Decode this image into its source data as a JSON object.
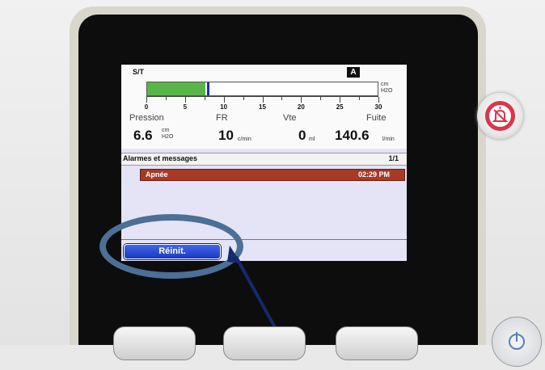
{
  "screen": {
    "mode": "S/T",
    "mode_badge": "A",
    "pressure_bar": {
      "scale_max": 30,
      "fill_value": 7.5,
      "marker_value": 7.8,
      "unit_top": "cm",
      "unit_bottom": "H2O",
      "ticks": [
        "0",
        "5",
        "10",
        "15",
        "20",
        "25",
        "30"
      ]
    },
    "params": [
      {
        "label": "Pression",
        "value": "6.6",
        "unit_top": "cm",
        "unit_bottom": "H2O"
      },
      {
        "label": "FR",
        "value": "10",
        "unit": "c/min"
      },
      {
        "label": "Vte",
        "value": "0",
        "unit": "ml"
      },
      {
        "label": "Fuite",
        "value": "140.6",
        "unit": "l/min"
      }
    ],
    "messages": {
      "title": "Alarmes et messages",
      "count": "1/1",
      "alarms": [
        {
          "name": "Apnée",
          "time": "02:29 PM"
        }
      ]
    },
    "reset_button": "Réinit."
  },
  "colors": {
    "bar_fill": "#58b649",
    "bar_marker": "#1b2fb8",
    "alarm_row": "#a73a25",
    "reset_button": "#2a4fd6",
    "highlight_ring": "#4b6f96",
    "arrow": "#16296b",
    "alarm_mute_ring": "#d9364c"
  },
  "icons": {
    "alarm_mute": "bell-slash-icon",
    "power": "power-icon"
  }
}
